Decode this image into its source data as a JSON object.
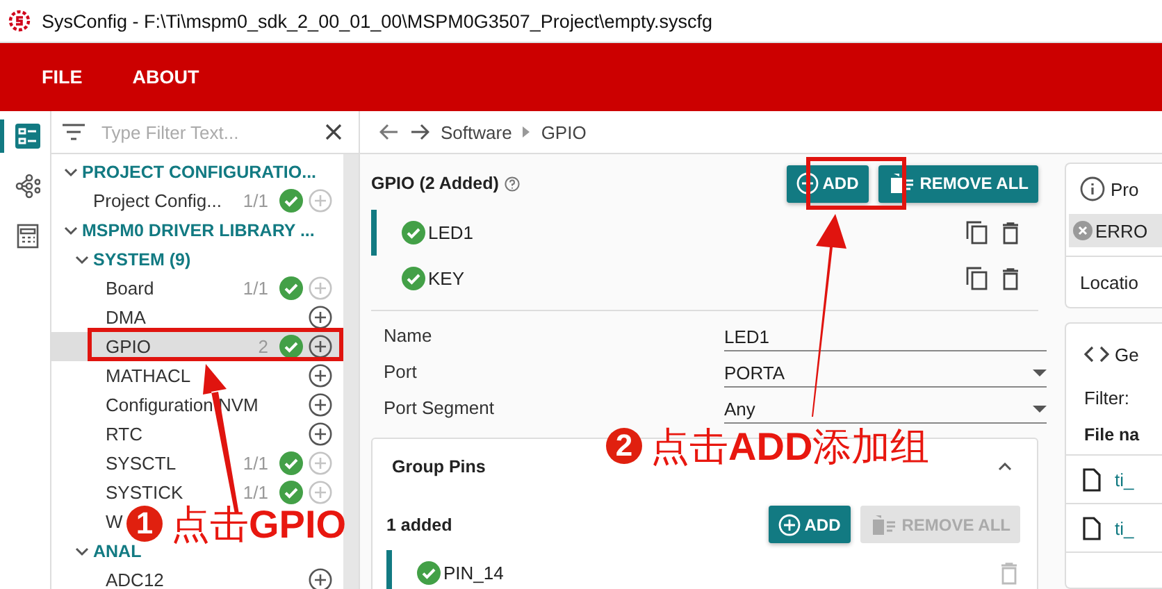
{
  "window": {
    "title": "SysConfig - F:\\Ti\\mspm0_sdk_2_00_01_00\\MSPM0G3507_Project\\empty.syscfg"
  },
  "menu": [
    "FILE",
    "ABOUT"
  ],
  "rail": [
    {
      "selected": true
    },
    {
      "selected": false
    },
    {
      "selected": false
    }
  ],
  "filter": {
    "placeholder": "Type Filter Text..."
  },
  "tree": [
    {
      "kind": "category",
      "label": "PROJECT CONFIGURATIO...",
      "expanded": true,
      "children": [
        {
          "kind": "module",
          "label": "Project Config...",
          "count": "1/1",
          "valid": true,
          "add_enabled": false,
          "selected": false
        }
      ]
    },
    {
      "kind": "category",
      "label": "MSPM0 DRIVER LIBRARY ...",
      "expanded": true,
      "children": [
        {
          "kind": "category",
          "label": "SYSTEM (9)",
          "expanded": true,
          "children": [
            {
              "kind": "module",
              "label": "Board",
              "count": "1/1",
              "valid": true,
              "add_enabled": false,
              "selected": false
            },
            {
              "kind": "module",
              "label": "DMA",
              "valid": false,
              "add_enabled": true,
              "selected": false
            },
            {
              "kind": "module",
              "label": "GPIO",
              "count": "2",
              "valid": true,
              "add_enabled": true,
              "selected": true
            },
            {
              "kind": "module",
              "label": "MATHACL",
              "valid": false,
              "add_enabled": true,
              "selected": false
            },
            {
              "kind": "module",
              "label": "Configuration NVM",
              "valid": false,
              "add_enabled": true,
              "selected": false
            },
            {
              "kind": "module",
              "label": "RTC",
              "valid": false,
              "add_enabled": true,
              "selected": false
            },
            {
              "kind": "module",
              "label": "SYSCTL",
              "count": "1/1",
              "valid": true,
              "add_enabled": false,
              "selected": false
            },
            {
              "kind": "module",
              "label": "SYSTICK",
              "count": "1/1",
              "valid": true,
              "add_enabled": false,
              "selected": false
            },
            {
              "kind": "module",
              "label": "W",
              "valid": false,
              "selected": false
            }
          ]
        },
        {
          "kind": "category",
          "label": "ANAL",
          "expanded": true,
          "children": [
            {
              "kind": "module",
              "label": "ADC12",
              "valid": false,
              "add_enabled": true,
              "selected": false
            }
          ]
        }
      ]
    }
  ],
  "breadcrumb": [
    "Software",
    "GPIO"
  ],
  "module": {
    "title": "GPIO (2 Added)",
    "add": "ADD",
    "remove_all": "REMOVE ALL",
    "instances": [
      {
        "name": "LED1",
        "valid": true,
        "selected": true
      },
      {
        "name": "KEY",
        "valid": true,
        "selected": false
      }
    ],
    "fields": [
      {
        "kind": "text",
        "label": "Name",
        "value": "LED1"
      },
      {
        "kind": "select",
        "label": "Port",
        "value": "PORTA"
      },
      {
        "kind": "select",
        "label": "Port Segment",
        "value": "Any"
      }
    ],
    "group": {
      "title": "Group Pins",
      "expanded": true,
      "count": "1 added",
      "add": "ADD",
      "remove_all": "REMOVE ALL",
      "remove_all_disabled": true,
      "pins": [
        {
          "name": "PIN_14",
          "valid": true,
          "selected": true
        }
      ]
    }
  },
  "right": {
    "info": "Pro",
    "error": "ERRO",
    "location": "Locatio",
    "generated": "Ge",
    "filter": "Filter:",
    "file_header": "File na",
    "files": [
      "ti_",
      "ti_"
    ]
  },
  "annotations": [
    {
      "number": "1",
      "text": "点击**GPIO**"
    },
    {
      "number": "2",
      "text": "点击**ADD**添加组"
    }
  ]
}
